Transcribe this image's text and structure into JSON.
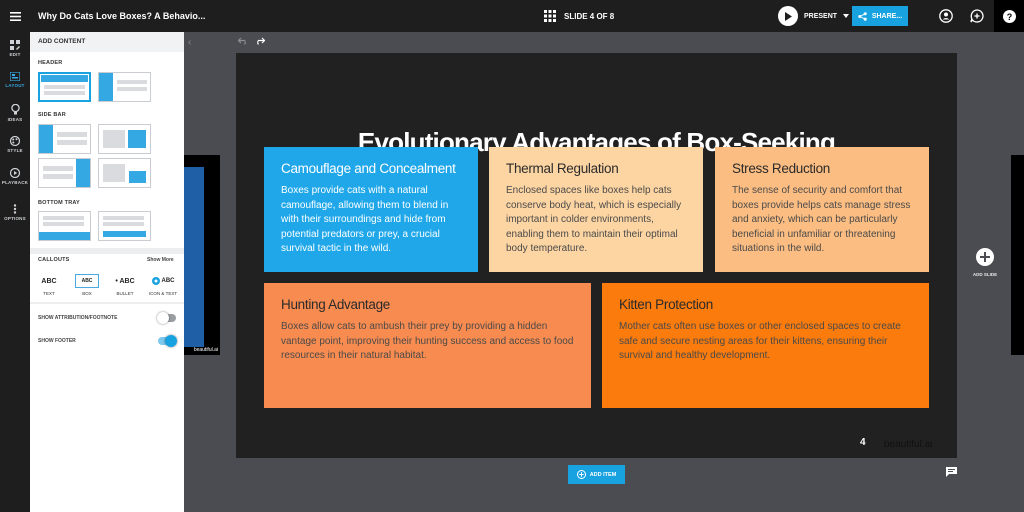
{
  "topbar": {
    "menu_icon": "hamburger-icon",
    "document_title": "Why Do Cats Love Boxes? A Behavio...",
    "slide_counter": "SLIDE 4 OF 8",
    "present_label": "PRESENT",
    "share_label": "SHARE...",
    "icons": [
      "grid-icon",
      "play-icon",
      "share-icon",
      "user-icon",
      "comment-add-icon",
      "help-icon"
    ]
  },
  "rail": {
    "items": [
      {
        "label": "EDIT",
        "icon": "edit-icon"
      },
      {
        "label": "LAYOUT",
        "icon": "layout-icon"
      },
      {
        "label": "IDEAS",
        "icon": "lightbulb-icon"
      },
      {
        "label": "STYLE",
        "icon": "palette-icon"
      },
      {
        "label": "PLAYBACK",
        "icon": "play-circle-icon"
      },
      {
        "label": "OPTIONS",
        "icon": "more-vertical-icon"
      }
    ],
    "active": "LAYOUT"
  },
  "panel": {
    "title": "ADD CONTENT",
    "header_section": "HEADER",
    "sidebar_section": "SIDE BAR",
    "bottom_tray_section": "BOTTOM TRAY",
    "callouts_section": "CALLOUTS",
    "show_more": "Show More",
    "callouts": [
      {
        "demo": "ABC",
        "caption": "TEXT"
      },
      {
        "demo": "ABC",
        "caption": "BOX"
      },
      {
        "demo": "• ABC",
        "caption": "BULLET"
      },
      {
        "demo": "ABC",
        "caption": "ICON & TEXT"
      }
    ],
    "toggles": [
      {
        "label": "SHOW ATTRIBUTION/FOOTNOTE",
        "on": false
      },
      {
        "label": "SHOW FOOTER",
        "on": true
      }
    ]
  },
  "slide": {
    "title": "Evolutionary Advantages of Box-Seeking",
    "cards": [
      {
        "title": "Camouflage and Concealment",
        "body": "Boxes provide cats with a natural camouflage, allowing them to blend in with their surroundings and hide from potential predators or prey, a crucial survival tactic in the wild.",
        "color": "#1fa7e9"
      },
      {
        "title": "Thermal Regulation",
        "body": "Enclosed spaces like boxes help cats conserve body heat, which is especially important in colder environments, enabling them to maintain their optimal body temperature.",
        "color": "#fdd5a3"
      },
      {
        "title": "Stress Reduction",
        "body": "The sense of security and comfort that boxes provide helps cats manage stress and anxiety, which can be particularly beneficial in unfamiliar or threatening situations in the wild.",
        "color": "#fbbd82"
      },
      {
        "title": "Hunting Advantage",
        "body": "Boxes allow cats to ambush their prey by providing a hidden vantage point, improving their hunting success and access to food resources in their natural habitat.",
        "color": "#f88b4f"
      },
      {
        "title": "Kitten Protection",
        "body": "Mother cats often use boxes or other enclosed spaces to create safe and secure nesting areas for their kittens, ensuring their survival and healthy development.",
        "color": "#fb7b0d"
      }
    ],
    "slide_number": "4",
    "brand": "beautiful.ai"
  },
  "left_thumbnail_tag": "beautiful.ai",
  "add_slide_label": "ADD SLIDE",
  "add_item_label": "ADD ITEM",
  "colors": {
    "accent": "#18a3e0",
    "topbar": "#1e1e1e",
    "workspace": "#4a4c51",
    "slide_bg": "#212121"
  }
}
